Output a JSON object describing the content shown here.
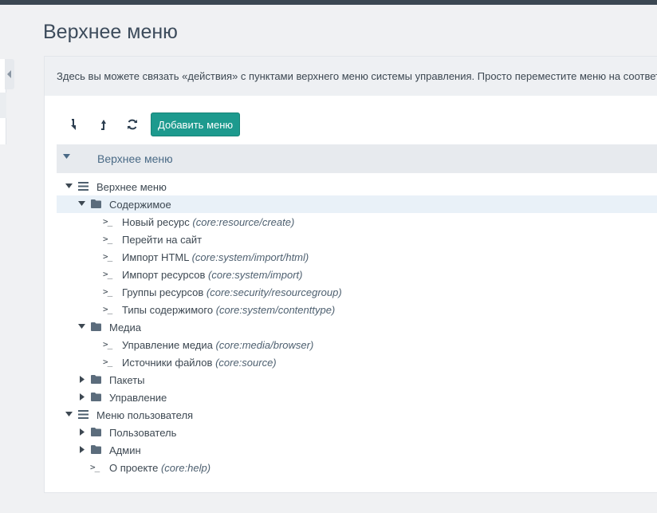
{
  "page": {
    "title": "Верхнее меню"
  },
  "info": {
    "text": "Здесь вы можете связать «действия» с пунктами верхнего меню системы управления. Просто переместите меню на соответ"
  },
  "toolbar": {
    "add_label": "Добавить меню"
  },
  "tree_header": {
    "label": "Верхнее меню"
  },
  "tree": {
    "items": [
      {
        "label": "Верхнее меню",
        "action": ""
      },
      {
        "label": "Содержимое",
        "action": ""
      },
      {
        "label": "Новый ресурс",
        "action": "(core:resource/create)"
      },
      {
        "label": "Перейти на сайт",
        "action": ""
      },
      {
        "label": "Импорт HTML",
        "action": "(core:system/import/html)"
      },
      {
        "label": "Импорт ресурсов",
        "action": "(core:system/import)"
      },
      {
        "label": "Группы ресурсов",
        "action": "(core:security/resourcegroup)"
      },
      {
        "label": "Типы содержимого",
        "action": "(core:system/contenttype)"
      },
      {
        "label": "Медиа",
        "action": ""
      },
      {
        "label": "Управление медиа",
        "action": "(core:media/browser)"
      },
      {
        "label": "Источники файлов",
        "action": "(core:source)"
      },
      {
        "label": "Пакеты",
        "action": ""
      },
      {
        "label": "Управление",
        "action": ""
      },
      {
        "label": "Меню пользователя",
        "action": ""
      },
      {
        "label": "Пользователь",
        "action": ""
      },
      {
        "label": "Админ",
        "action": ""
      },
      {
        "label": "О проекте",
        "action": "(core:help)"
      }
    ]
  },
  "icons": {
    "expand": "expand-all-icon",
    "collapse": "collapse-all-icon",
    "refresh": "refresh-icon",
    "caret_down": "caret-down-icon",
    "caret_right": "caret-right-icon",
    "menu": "menu-bars-icon",
    "folder": "folder-icon",
    "action": "terminal-icon"
  },
  "colors": {
    "accent": "#1d9a8e",
    "selected_row": "#e9f1f8",
    "header_bg": "#e7eaee"
  }
}
